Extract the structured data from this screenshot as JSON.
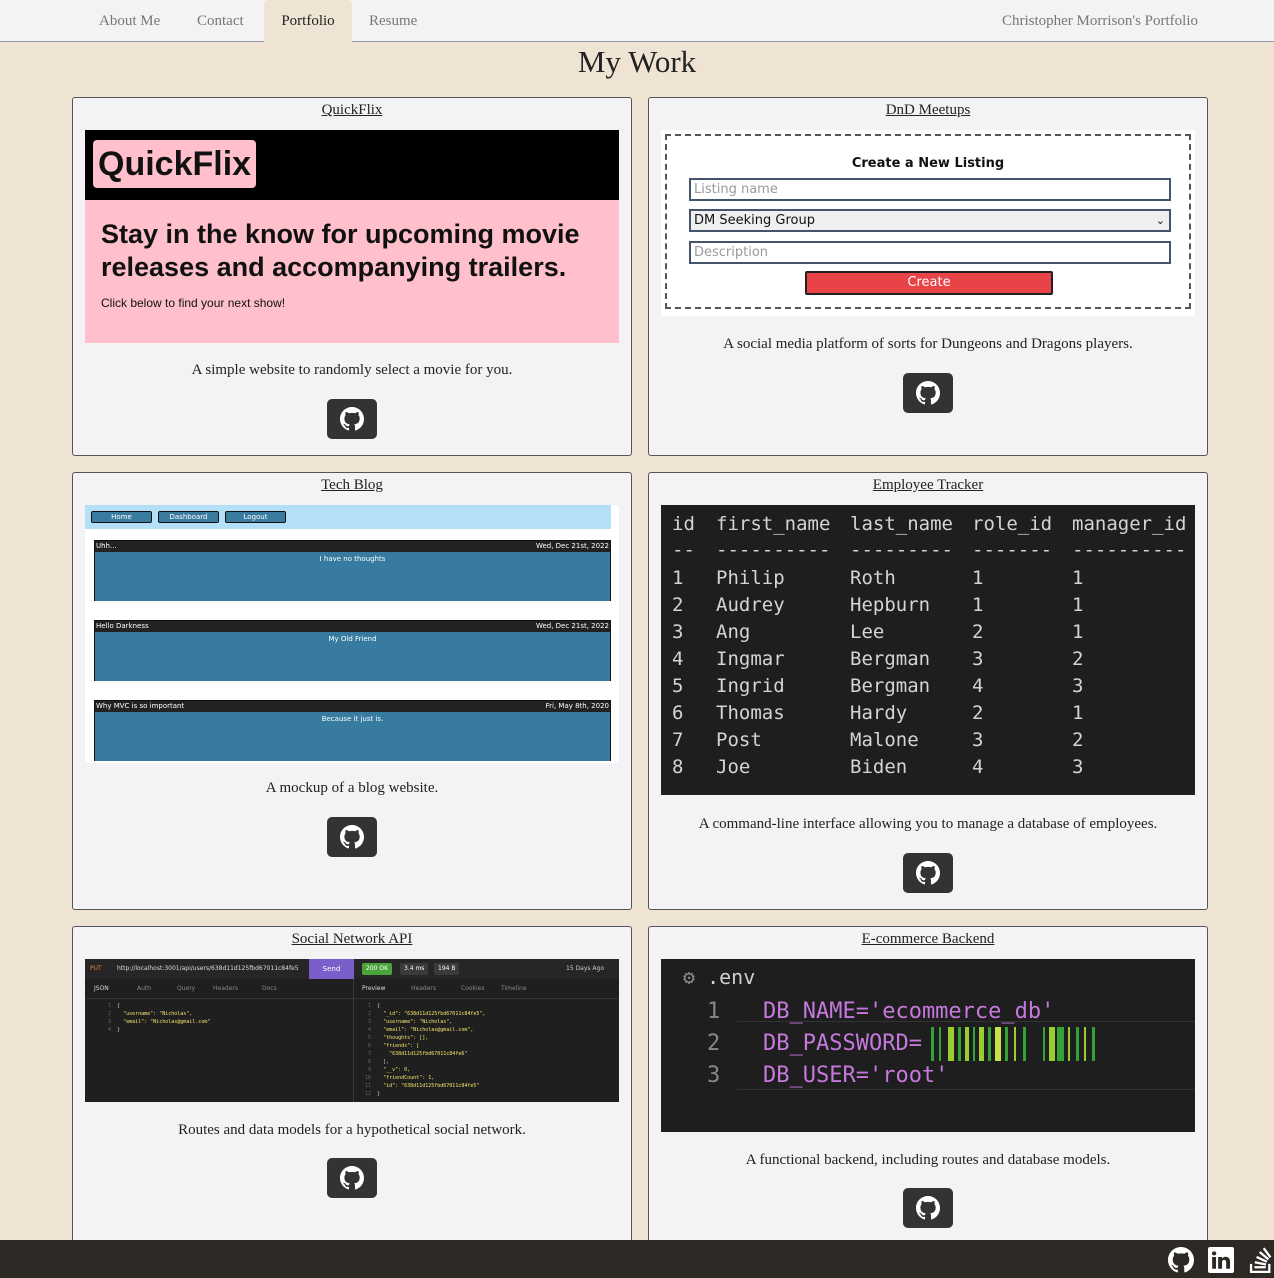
{
  "nav": {
    "tabs": [
      "About Me",
      "Contact",
      "Portfolio",
      "Resume"
    ],
    "active": "Portfolio",
    "brand": "Christopher Morrison's Portfolio"
  },
  "page": {
    "title": "My Work"
  },
  "projects": [
    {
      "title": "QuickFlix",
      "description": "A simple website to randomly select a movie for you.",
      "preview": {
        "logo": "QuickFlix",
        "headline": "Stay in the know for upcoming movie releases and accompanying trailers.",
        "subtext": "Click below to find your next show!",
        "colors": {
          "top": "#000000",
          "body": "#ffc0cb"
        }
      }
    },
    {
      "title": "DnD Meetups",
      "description": "A social media platform of sorts for Dungeons and Dragons players.",
      "preview": {
        "heading": "Create a New Listing",
        "name_placeholder": "Listing name",
        "select_value": "DM Seeking Group",
        "description_placeholder": "Description",
        "button": "Create",
        "button_color": "#e84448"
      }
    },
    {
      "title": "Tech Blog",
      "description": "A mockup of a blog website.",
      "preview": {
        "nav": [
          "Home",
          "Dashboard",
          "Logout"
        ],
        "posts": [
          {
            "title": "Uhh...",
            "date": "Wed, Dec 21st, 2022",
            "body": "I have no thoughts"
          },
          {
            "title": "Hello Darkness",
            "date": "Wed, Dec 21st, 2022",
            "body": "My Old Friend"
          },
          {
            "title": "Why MVC is so important",
            "date": "Fri, May 8th, 2020",
            "body": "Because it just is."
          }
        ]
      }
    },
    {
      "title": "Employee Tracker",
      "description": "A command-line interface allowing you to manage a database of employees.",
      "preview": {
        "columns": [
          "id",
          "first_name",
          "last_name",
          "role_id",
          "manager_id"
        ],
        "separators": [
          "--",
          "----------",
          "---------",
          "-------",
          "----------"
        ],
        "rows": [
          [
            "1",
            "Philip",
            "Roth",
            "1",
            "1"
          ],
          [
            "2",
            "Audrey",
            "Hepburn",
            "1",
            "1"
          ],
          [
            "3",
            "Ang",
            "Lee",
            "2",
            "1"
          ],
          [
            "4",
            "Ingmar",
            "Bergman",
            "3",
            "2"
          ],
          [
            "5",
            "Ingrid",
            "Bergman",
            "4",
            "3"
          ],
          [
            "6",
            "Thomas",
            "Hardy",
            "2",
            "1"
          ],
          [
            "7",
            "Post",
            "Malone",
            "3",
            "2"
          ],
          [
            "8",
            "Joe",
            "Biden",
            "4",
            "3"
          ]
        ]
      }
    },
    {
      "title": "Social Network API",
      "description": "Routes and data models for a hypothetical social network.",
      "preview": {
        "method": "PUT",
        "url": "http://localhost:3001/api/users/638d11d125fbd67011c84fe5",
        "send": "Send",
        "status": "200 OK",
        "time": "3.4 ms",
        "size": "194 B",
        "ago": "15 Days Ago",
        "left_tabs": [
          "JSON",
          "Auth",
          "Query",
          "Headers",
          "Docs"
        ],
        "right_tabs": [
          "Preview",
          "Headers",
          "Cookies",
          "Timeline"
        ],
        "request_lines": [
          "{",
          "  \"username\": \"Nicholas\",",
          "  \"email\": \"Nicholas@gmail.com\"",
          "}"
        ],
        "response_lines": [
          "{",
          "  \"_id\": \"638d11d125fbd67011c84fe5\",",
          "  \"username\": \"Nicholas\",",
          "  \"email\": \"Nicholas@gmail.com\",",
          "  \"thoughts\": [],",
          "  \"friends\": [",
          "    \"638d11d125fbd67011c84fe6\"",
          "  ],",
          "  \"__v\": 0,",
          "  \"friendCount\": 1,",
          "  \"id\": \"638d11d125fbd67011c84fe5\"",
          "}"
        ]
      }
    },
    {
      "title": "E-commerce Backend",
      "description": "A functional backend, including routes and database models.",
      "preview": {
        "filename": ".env",
        "lines": [
          {
            "n": "1",
            "text": "DB_NAME='ecommerce_db'"
          },
          {
            "n": "2",
            "text": "DB_PASSWORD="
          },
          {
            "n": "3",
            "text": "DB_USER='root'"
          }
        ]
      }
    }
  ],
  "footer": {
    "icons": [
      "github-icon",
      "linkedin-icon",
      "stackoverflow-icon"
    ]
  }
}
